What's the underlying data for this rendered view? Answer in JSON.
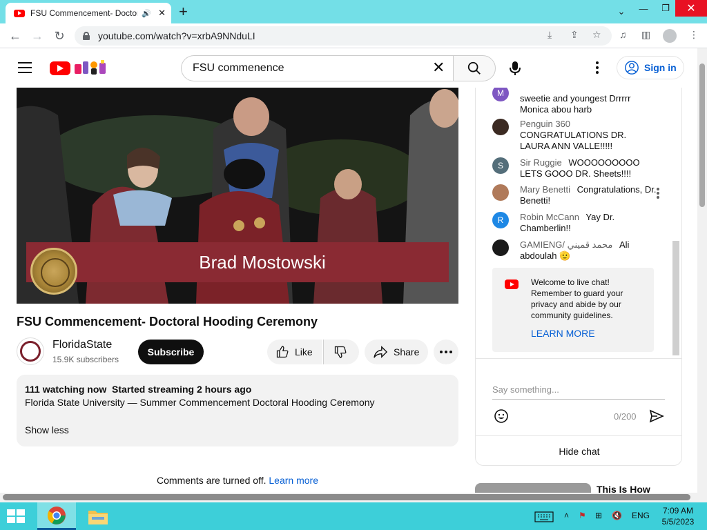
{
  "browser": {
    "tab_title": "FSU Commencement- Doctoral Hooding Ceremony",
    "url": "youtube.com/watch?v=xrbA9NNduLI"
  },
  "header": {
    "search_query": "FSU commenence",
    "sign_in_label": "Sign in"
  },
  "player": {
    "caption_name": "Brad Mostowski"
  },
  "video": {
    "title": "FSU Commencement- Doctoral Hooding Ceremony",
    "channel_name": "FloridaState",
    "subscribers": "15.9K subscribers",
    "subscribe_label": "Subscribe",
    "like_label": "Like",
    "share_label": "Share"
  },
  "description": {
    "watching": "111 watching now",
    "started": "Started streaming 2 hours ago",
    "text": "Florida State University — Summer Commencement Doctoral Hooding Ceremony",
    "show_less": "Show less"
  },
  "comments": {
    "off_text": "Comments are turned off.",
    "learn_more": "Learn more"
  },
  "chat": {
    "messages": [
      {
        "initial": "M",
        "avatar_color": "#7e57c2",
        "author": "",
        "text": "sweetie and youngest Drrrrr Monica abou harb"
      },
      {
        "initial": "",
        "avatar_color": "#3b2a22",
        "author": "Penguin 360",
        "text": "CONGRATULATIONS DR. LAURA ANN VALLE!!!!!"
      },
      {
        "initial": "S",
        "avatar_color": "#546e7a",
        "author": "Sir Ruggie",
        "text": "WOOOOOOOOO LETS GOOO DR. Sheets!!!!"
      },
      {
        "initial": "",
        "avatar_color": "#b07a5a",
        "author": "Mary Benetti",
        "text": "Congratulations, Dr. Benetti!"
      },
      {
        "initial": "R",
        "avatar_color": "#1e88e5",
        "author": "Robin McCann",
        "text": "Yay Dr. Chamberlin!!"
      },
      {
        "initial": "",
        "avatar_color": "#1a1a1a",
        "author": "GAMIENG/ محمد قميني",
        "text": "Ali abdoulah 🫡"
      }
    ],
    "welcome_text": "Welcome to live chat! Remember to guard your privacy and abide by our community guidelines.",
    "learn_more": "LEARN MORE",
    "input_placeholder": "Say something...",
    "char_counter": "0/200",
    "hide_chat": "Hide chat"
  },
  "next_video": {
    "title": "This Is How"
  },
  "taskbar": {
    "language": "ENG",
    "time": "7:09 AM",
    "date": "5/5/2023"
  },
  "colors": {
    "tabstrip": "#73dfe7",
    "taskbar": "#3dcfd9",
    "youtube_red": "#ff0000",
    "link_blue": "#065fd4",
    "fsu_garnet": "#8a2a33"
  }
}
